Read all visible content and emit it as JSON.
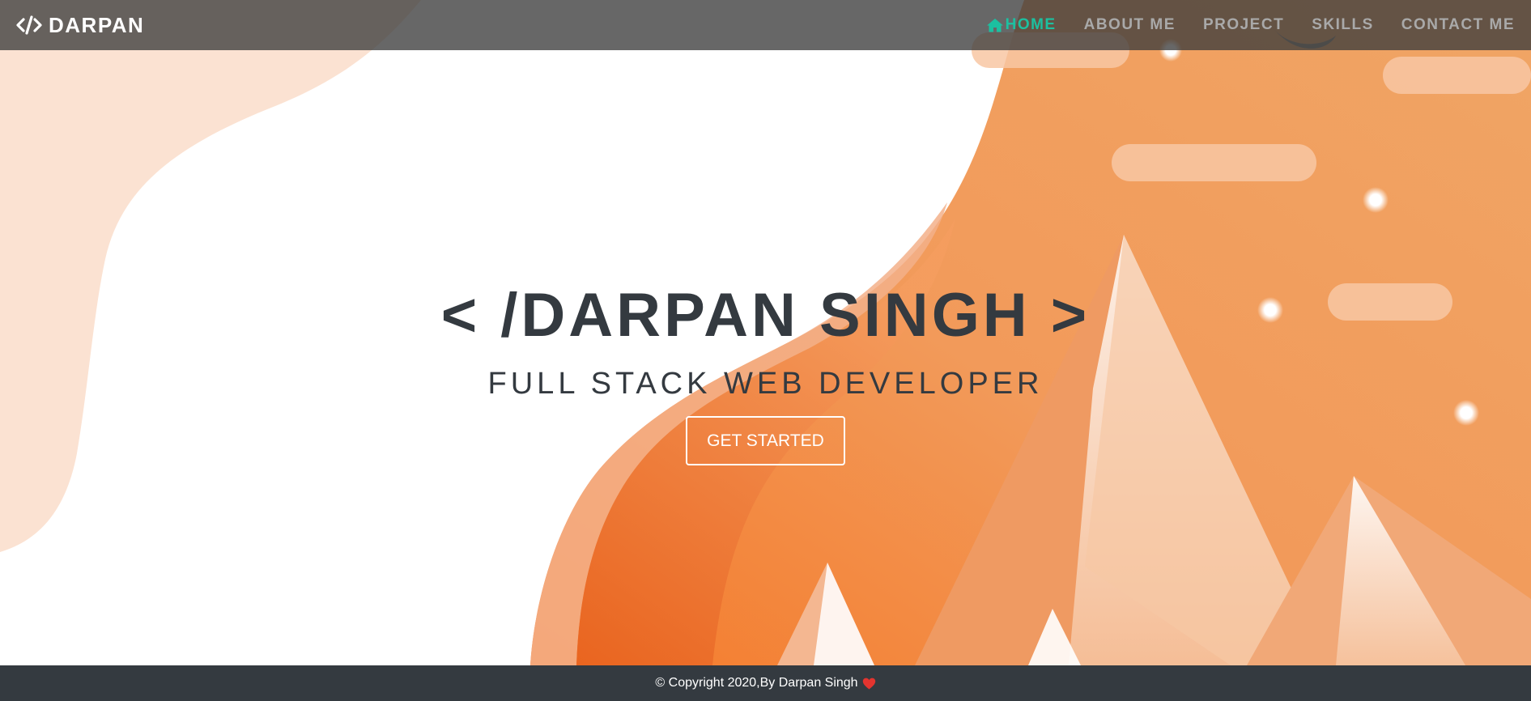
{
  "navbar": {
    "brand_icon": "code-icon",
    "brand_text": "DARPAN",
    "links": [
      {
        "label": "HOME",
        "icon": "home-icon",
        "active": true
      },
      {
        "label": "ABOUT ME",
        "active": false
      },
      {
        "label": "PROJECT",
        "active": false
      },
      {
        "label": "SKILLS",
        "active": false
      },
      {
        "label": "CONTACT ME",
        "active": false
      }
    ]
  },
  "hero": {
    "title": "< /DARPAN SINGH >",
    "subtitle": "FULL STACK WEB DEVELOPER",
    "cta_label": "GET STARTED"
  },
  "footer": {
    "text": "© Copyright 2020,By Darpan Singh",
    "icon": "heart-icon"
  },
  "colors": {
    "nav_background": "#3c3c3c",
    "nav_active": "#1cc0a0",
    "nav_inactive": "#a9a9a9",
    "text_dark": "#343a40",
    "accent_orange": "#f08a45",
    "footer_background": "#343a40",
    "heart": "#e3342f"
  }
}
